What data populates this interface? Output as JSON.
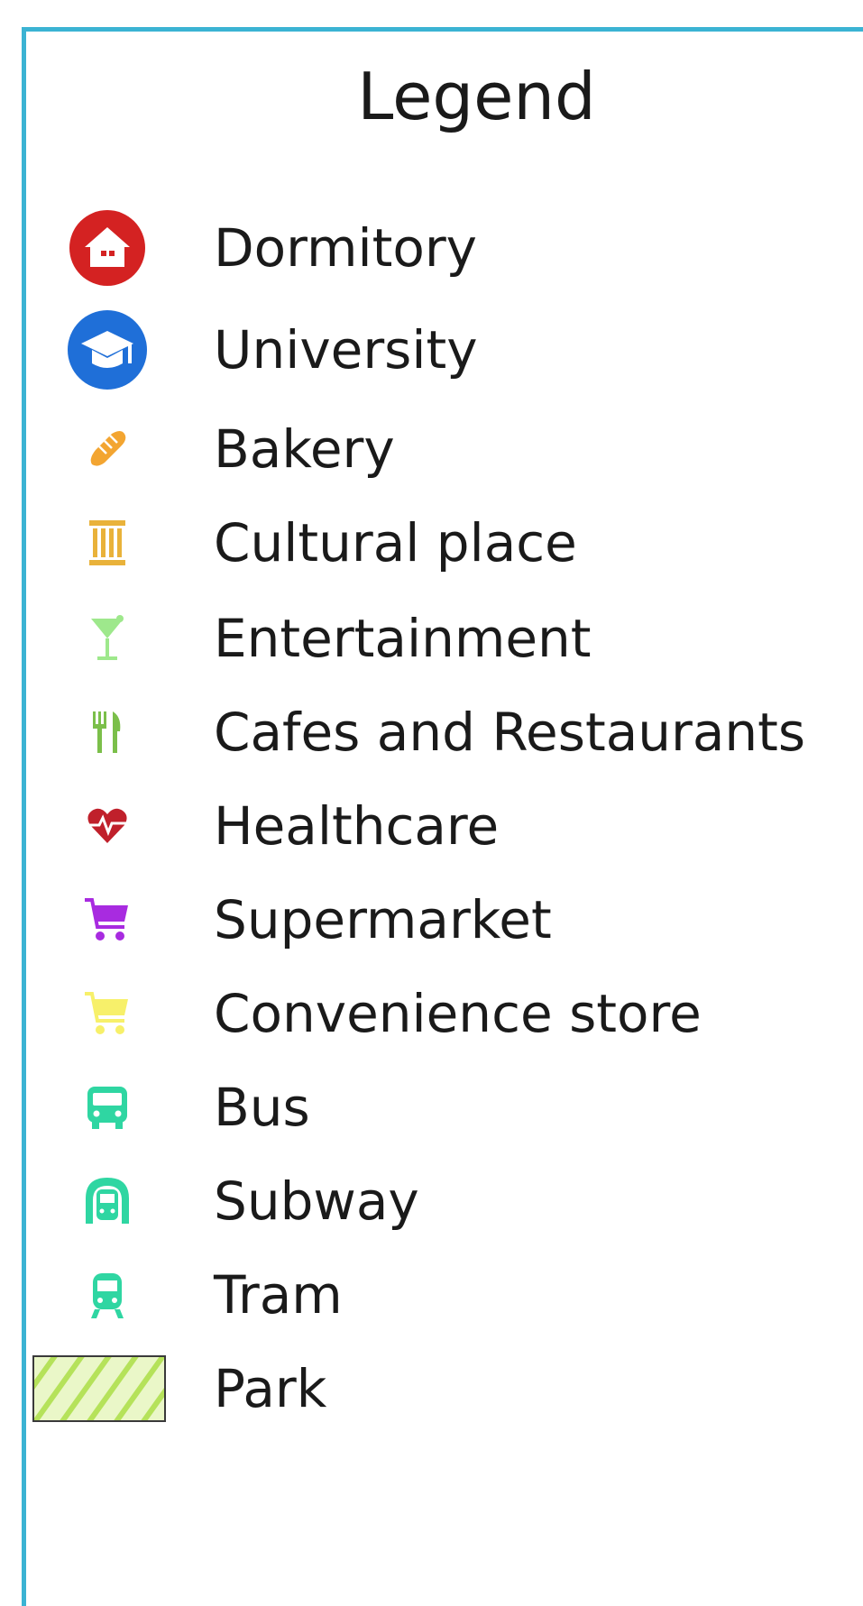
{
  "legend": {
    "title": "Legend",
    "items": [
      {
        "label": "Dormitory",
        "icon": "home-circle-icon",
        "color": "#d42222"
      },
      {
        "label": "University",
        "icon": "graduation-cap-circle-icon",
        "color": "#1f6fd8"
      },
      {
        "label": "Bakery",
        "icon": "bread-icon",
        "color": "#f3a531"
      },
      {
        "label": "Cultural place",
        "icon": "column-icon",
        "color": "#e9b23a"
      },
      {
        "label": "Entertainment",
        "icon": "cocktail-icon",
        "color": "#9ee88c"
      },
      {
        "label": "Cafes and Restaurants",
        "icon": "fork-knife-icon",
        "color": "#7bbf4a"
      },
      {
        "label": "Healthcare",
        "icon": "heartbeat-icon",
        "color": "#c0202b"
      },
      {
        "label": "Supermarket",
        "icon": "shopping-cart-icon",
        "color": "#a82be0"
      },
      {
        "label": "Convenience store",
        "icon": "shopping-cart-icon",
        "color": "#f7f06a"
      },
      {
        "label": "Bus",
        "icon": "bus-icon",
        "color": "#2fd6a2"
      },
      {
        "label": "Subway",
        "icon": "subway-icon",
        "color": "#2fd6a2"
      },
      {
        "label": "Tram",
        "icon": "tram-icon",
        "color": "#2fd6a2"
      },
      {
        "label": "Park",
        "icon": "hatched-area-icon",
        "color": "#b5e25a"
      }
    ]
  }
}
